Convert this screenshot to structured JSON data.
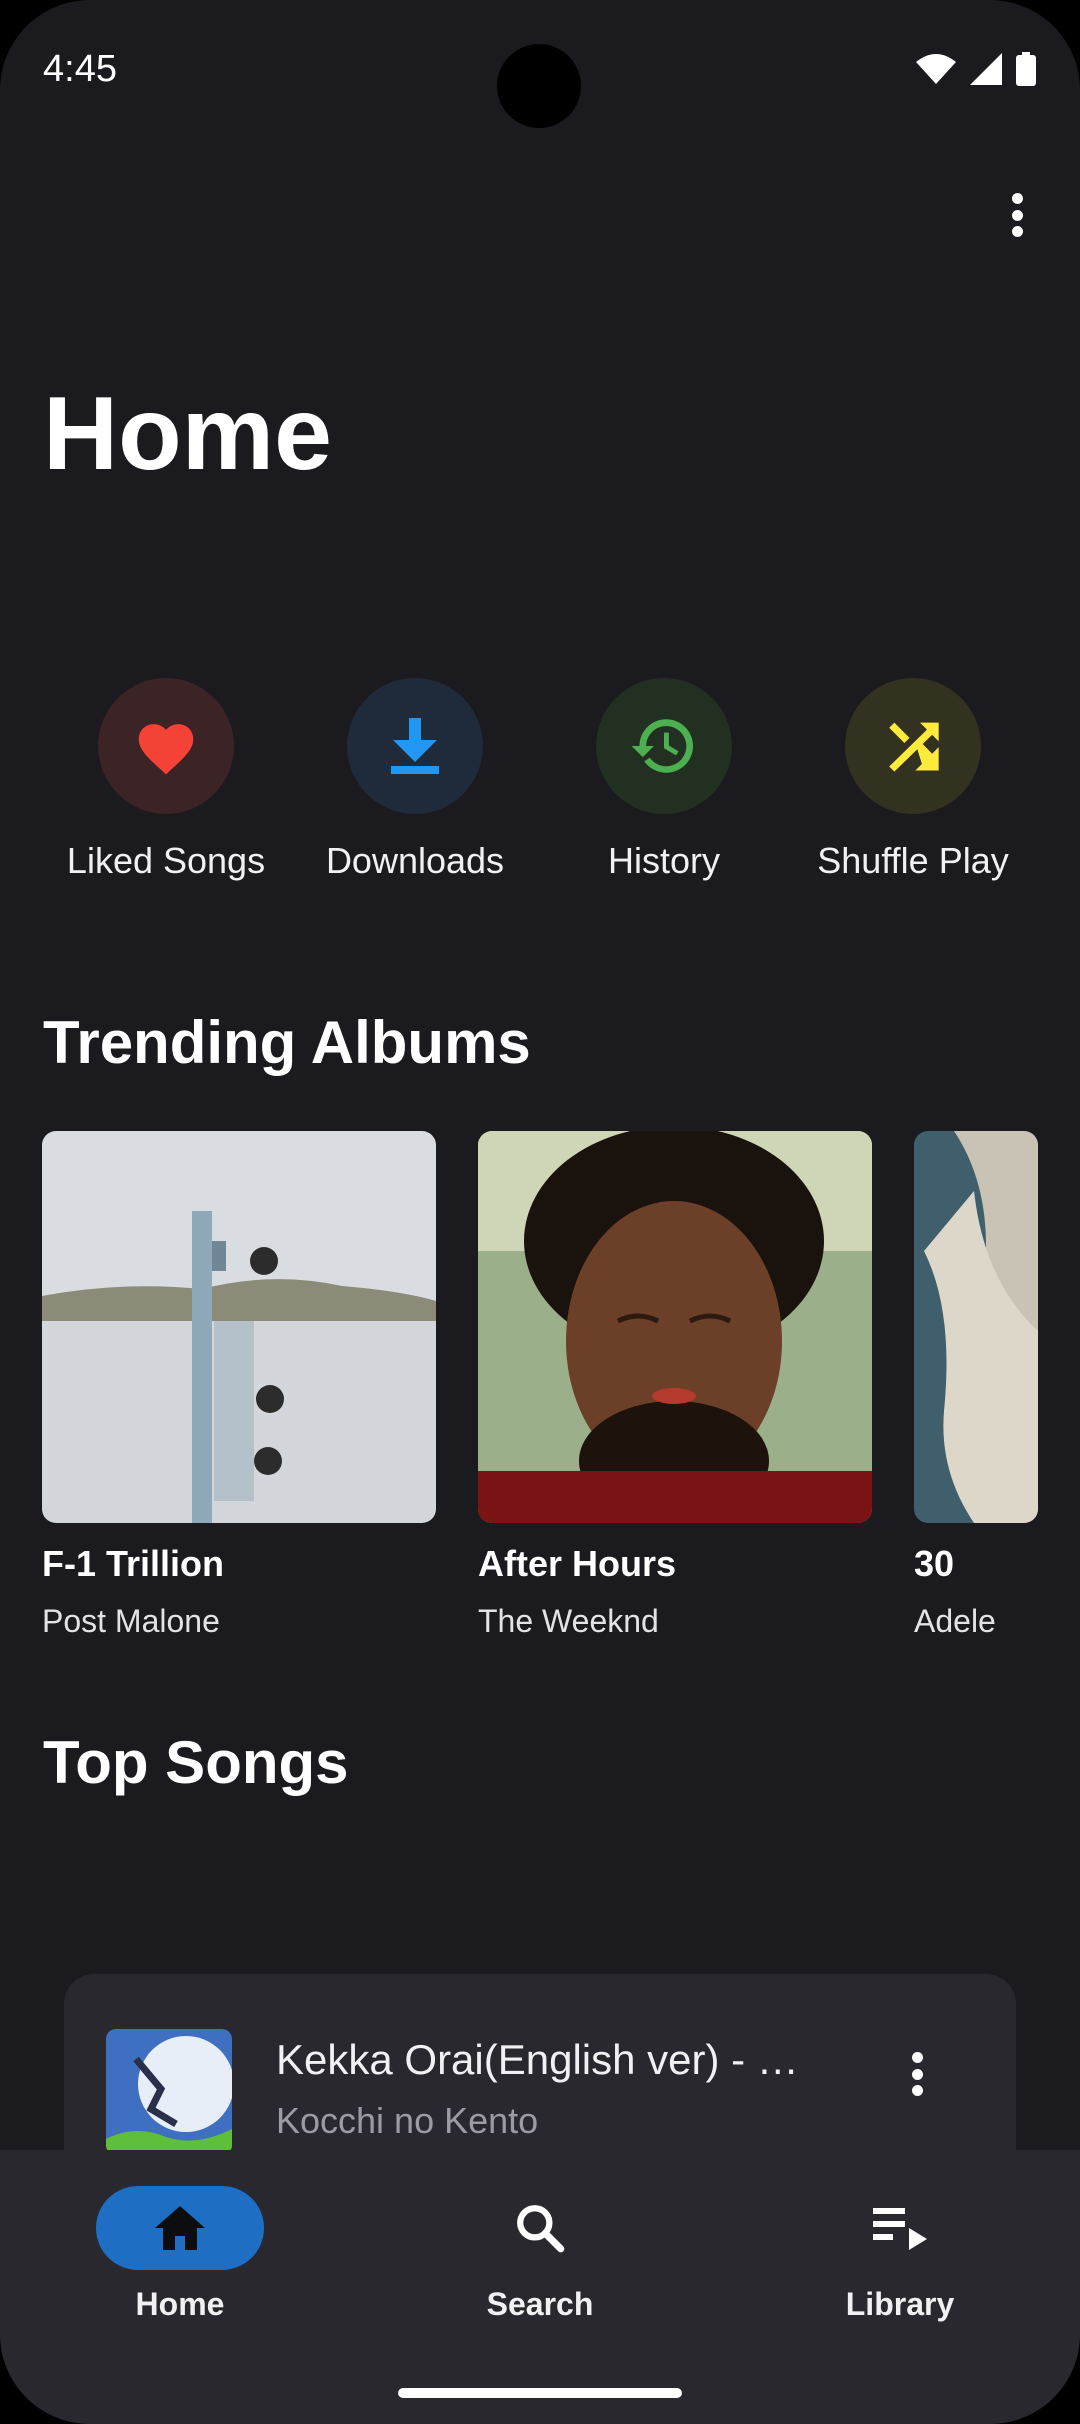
{
  "status_bar": {
    "time": "4:45"
  },
  "header": {
    "title": "Home"
  },
  "quick_actions": [
    {
      "label": "Liked Songs",
      "icon": "heart-icon",
      "color": "#f44336",
      "bg": "#3b2326"
    },
    {
      "label": "Downloads",
      "icon": "download-icon",
      "color": "#2196f3",
      "bg": "#1f2a3a"
    },
    {
      "label": "History",
      "icon": "history-icon",
      "color": "#4caf50",
      "bg": "#223022"
    },
    {
      "label": "Shuffle Play",
      "icon": "shuffle-icon",
      "color": "#ffeb3b",
      "bg": "#33311f"
    }
  ],
  "sections": {
    "trending_albums": "Trending Albums",
    "top_songs": "Top Songs"
  },
  "albums": [
    {
      "title": "F-1 Trillion",
      "artist": "Post Malone"
    },
    {
      "title": "After Hours",
      "artist": "The Weeknd"
    },
    {
      "title": "30",
      "artist": "Adele"
    }
  ],
  "now_playing": {
    "title": "Kekka Orai(English ver) - …",
    "artist": "Kocchi no Kento"
  },
  "nav": [
    {
      "label": "Home",
      "icon": "home-icon",
      "active": true
    },
    {
      "label": "Search",
      "icon": "search-icon",
      "active": false
    },
    {
      "label": "Library",
      "icon": "library-icon",
      "active": false
    }
  ],
  "colors": {
    "background": "#1b1a1f",
    "surface": "#29282e",
    "accent": "#1e6fc4"
  }
}
